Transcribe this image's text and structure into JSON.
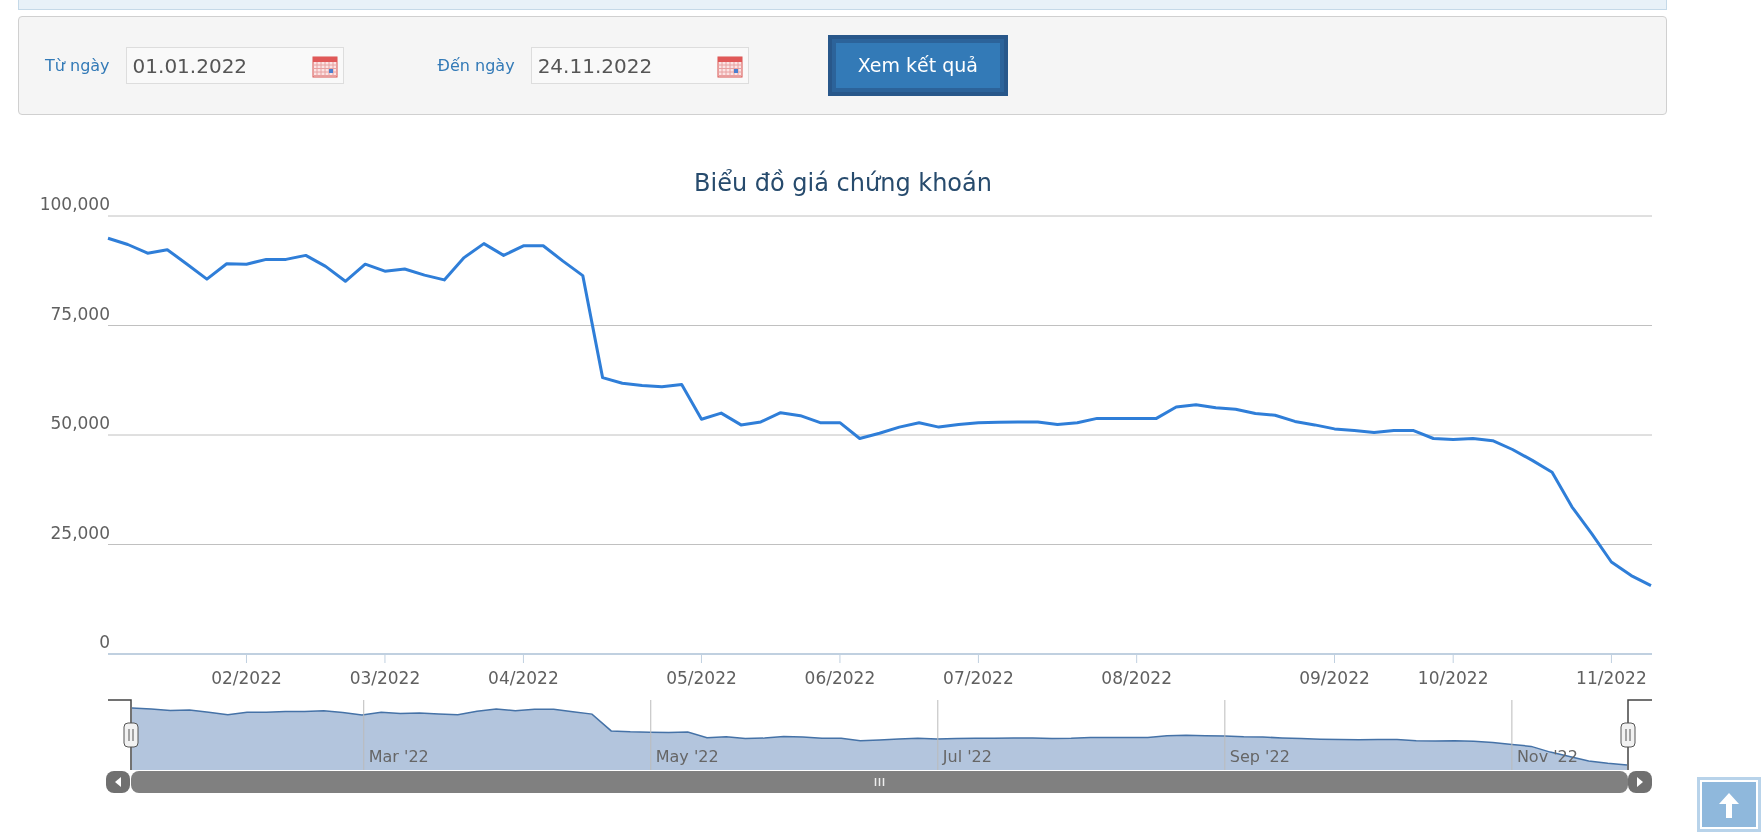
{
  "date_filter": {
    "from": {
      "label": "Từ ngày",
      "value": "01.01.2022"
    },
    "to": {
      "label": "Đến ngày",
      "value": "24.11.2022"
    },
    "submit": "Xem kết quả"
  },
  "chart": {
    "chart_data": {
      "type": "line",
      "title": "Biểu đồ giá chứng khoán",
      "categories": [
        null,
        null,
        null,
        null,
        null,
        null,
        null,
        "02/2022",
        null,
        null,
        null,
        null,
        null,
        null,
        "03/2022",
        null,
        null,
        null,
        null,
        null,
        null,
        "04/2022",
        null,
        null,
        null,
        null,
        null,
        null,
        null,
        null,
        "05/2022",
        null,
        null,
        null,
        null,
        null,
        null,
        "06/2022",
        null,
        null,
        null,
        null,
        null,
        null,
        "07/2022",
        null,
        null,
        null,
        null,
        null,
        null,
        null,
        "08/2022",
        null,
        null,
        null,
        null,
        null,
        null,
        null,
        null,
        null,
        "09/2022",
        null,
        null,
        null,
        null,
        null,
        "10/2022",
        null,
        null,
        null,
        null,
        null,
        null,
        null,
        "11/2022",
        null,
        null
      ],
      "values": [
        94900,
        93500,
        91500,
        92300,
        89000,
        85600,
        89100,
        89000,
        90100,
        90100,
        91000,
        88500,
        85100,
        89000,
        87400,
        87900,
        86500,
        85400,
        90500,
        93700,
        91000,
        93200,
        93200,
        89700,
        86400,
        63100,
        61800,
        61300,
        61000,
        61500,
        53600,
        55000,
        52300,
        53000,
        55100,
        54400,
        52800,
        52800,
        49200,
        50400,
        51800,
        52800,
        51800,
        52400,
        52800,
        52900,
        53000,
        53000,
        52400,
        52800,
        53800,
        53800,
        53800,
        53800,
        56400,
        56900,
        56200,
        55900,
        54900,
        54500,
        53100,
        52300,
        51400,
        51000,
        50600,
        51000,
        51000,
        49200,
        49000,
        49200,
        48700,
        46700,
        44200,
        41500,
        33600,
        27500,
        21000,
        17900,
        15600
      ],
      "grid": true,
      "ylim": [
        0,
        100000
      ],
      "yticks": [
        {
          "value": 0,
          "label": "0"
        },
        {
          "value": 25000,
          "label": "25,000"
        },
        {
          "value": 50000,
          "label": "50,000"
        },
        {
          "value": 75000,
          "label": "75,000"
        },
        {
          "value": 100000,
          "label": "100,000"
        }
      ]
    }
  },
  "navigator": {
    "tick_labels": [
      "Mar '22",
      "May '22",
      "Jul '22",
      "Sep '22",
      "Nov '22"
    ]
  }
}
